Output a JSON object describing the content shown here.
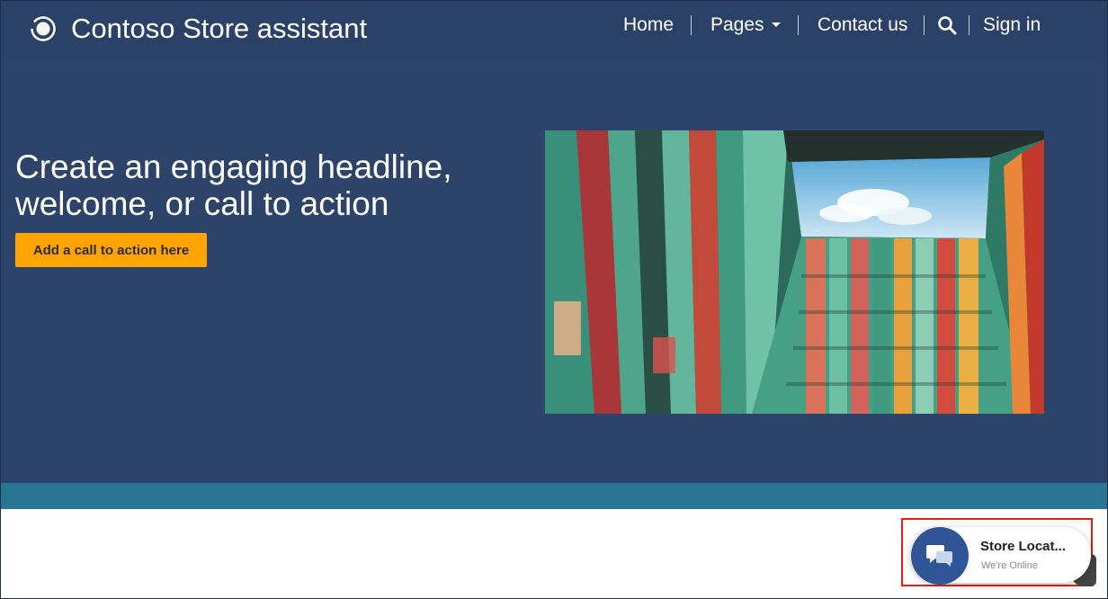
{
  "header": {
    "brand": "Contoso Store assistant",
    "nav": {
      "home": "Home",
      "pages": "Pages",
      "contact": "Contact us",
      "signin": "Sign in"
    }
  },
  "hero": {
    "headline_line1": "Create an engaging headline,",
    "headline_line2": "welcome, or call to action",
    "cta_label": "Add a call to action here"
  },
  "chat_widget": {
    "title": "Store Locat...",
    "status": "We're Online"
  },
  "colors": {
    "nav_bg": "#2c4168",
    "hero_bg": "#2e4369",
    "cta": "#ffa400",
    "strip": "#2a7594",
    "chat_button": "#2f5597",
    "highlight": "#e01e1e"
  },
  "icons": [
    "brand-logo-icon",
    "chevron-down-icon",
    "search-icon",
    "chat-bubbles-icon"
  ]
}
